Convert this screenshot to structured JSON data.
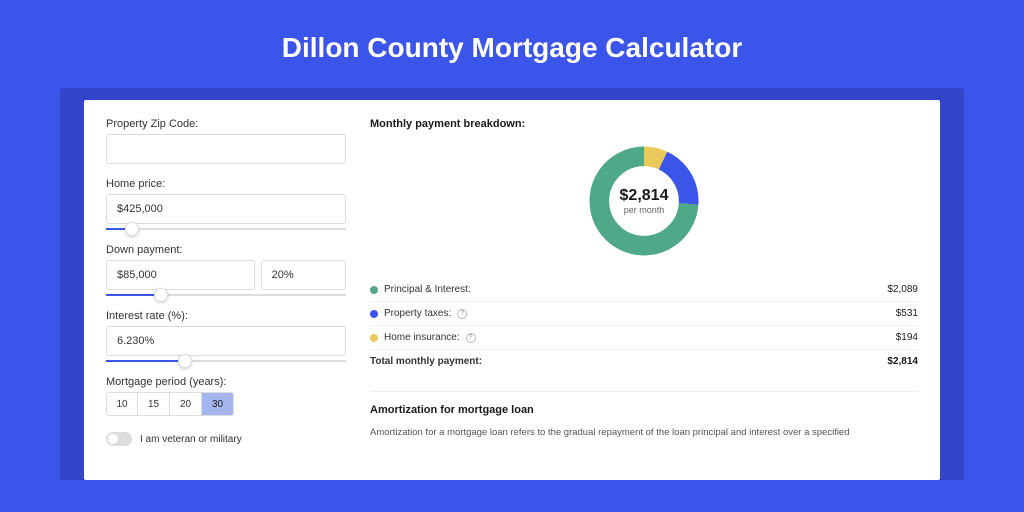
{
  "title": "Dillon County Mortgage Calculator",
  "form": {
    "zip_label": "Property Zip Code:",
    "zip_value": "",
    "home_price_label": "Home price:",
    "home_price_value": "$425,000",
    "home_price_slider_pct": 8,
    "down_payment_label": "Down payment:",
    "down_payment_value": "$85,000",
    "down_payment_pct": "20%",
    "down_payment_slider_pct": 20,
    "interest_label": "Interest rate (%):",
    "interest_value": "6.230%",
    "interest_slider_pct": 30,
    "period_label": "Mortgage period (years):",
    "periods": [
      "10",
      "15",
      "20",
      "30"
    ],
    "period_active": "30",
    "veteran_label": "I am veteran or military"
  },
  "breakdown": {
    "title": "Monthly payment breakdown:",
    "total_value": "$2,814",
    "per_month": "per month",
    "items": [
      {
        "label": "Principal & Interest:",
        "value": "$2,089",
        "color": "#4fa887",
        "pct": 74
      },
      {
        "label": "Property taxes:",
        "value": "$531",
        "color": "#3b54ea",
        "pct": 19,
        "info": true
      },
      {
        "label": "Home insurance:",
        "value": "$194",
        "color": "#e8c95a",
        "pct": 7,
        "info": true
      }
    ],
    "total_label": "Total monthly payment:",
    "total": "$2,814"
  },
  "amort": {
    "title": "Amortization for mortgage loan",
    "text": "Amortization for a mortgage loan refers to the gradual repayment of the loan principal and interest over a specified"
  },
  "chart_data": {
    "type": "pie",
    "title": "Monthly payment breakdown",
    "values": [
      2089,
      531,
      194
    ],
    "categories": [
      "Principal & Interest",
      "Property taxes",
      "Home insurance"
    ],
    "series": [
      {
        "name": "Monthly payment",
        "values": [
          2089,
          531,
          194
        ]
      }
    ],
    "total": 2814,
    "colors": [
      "#4fa887",
      "#3b54ea",
      "#e8c95a"
    ]
  }
}
